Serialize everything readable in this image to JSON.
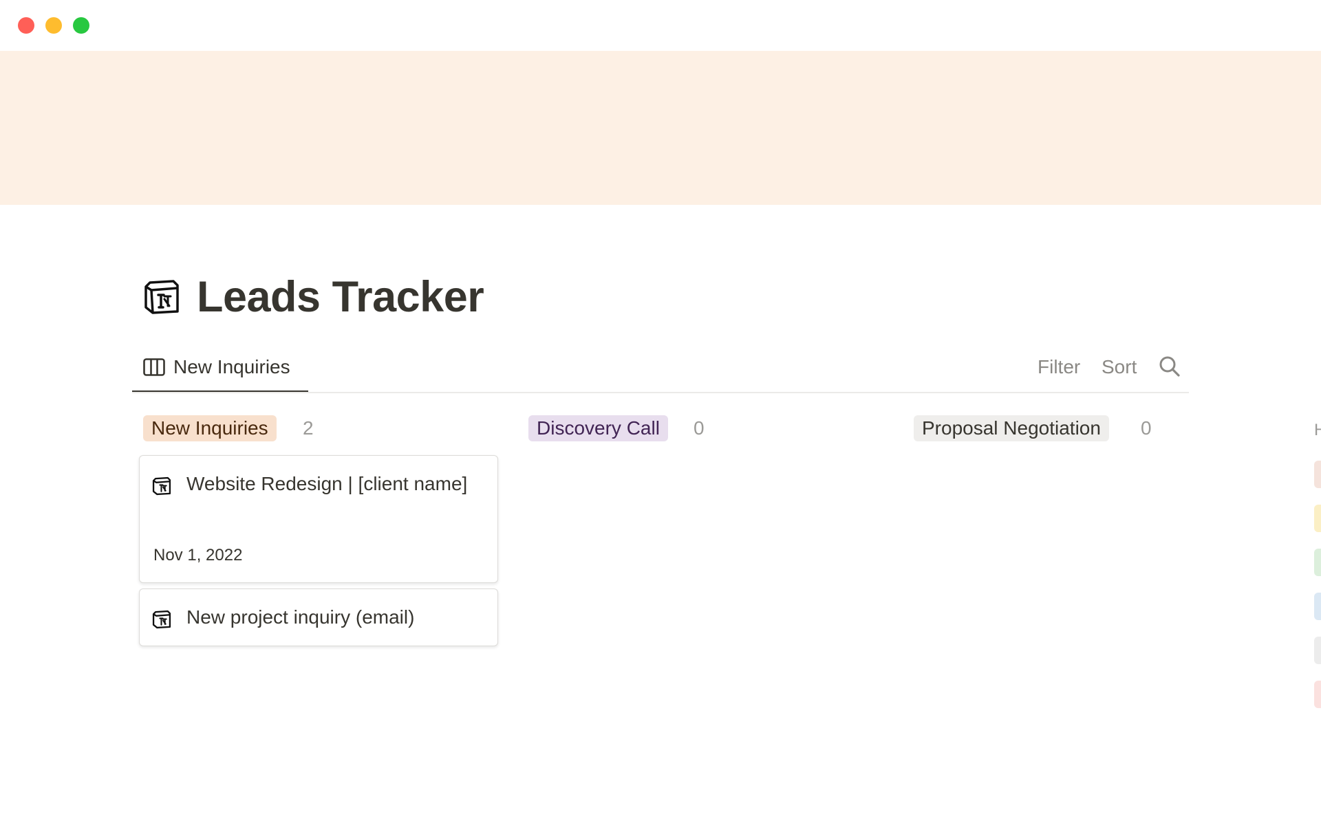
{
  "window": {
    "traffic_lights": [
      "close",
      "minimize",
      "maximize"
    ]
  },
  "page": {
    "title": "Leads Tracker",
    "icon": "notion-logo-icon",
    "cover_color": "#fdf0e4"
  },
  "view": {
    "tab_label": "New Inquiries",
    "tab_icon": "board-view-icon",
    "actions": {
      "filter": "Filter",
      "sort": "Sort",
      "search_icon": "search-icon"
    }
  },
  "board": {
    "columns": [
      {
        "label": "New Inquiries",
        "count": "2",
        "tag_color": "#f8e0cd",
        "cards": [
          {
            "title": "Website Redesign | [client name]",
            "date": "Nov 1, 2022",
            "icon": "notion-page-icon"
          },
          {
            "title": "New project inquiry (email)",
            "icon": "notion-page-icon"
          }
        ]
      },
      {
        "label": "Discovery Call",
        "count": "0",
        "tag_color": "#e8deee",
        "cards": []
      },
      {
        "label": "Proposal Negotiation",
        "count": "0",
        "tag_color": "#efeeec",
        "cards": []
      }
    ],
    "offscreen_column_colors": [
      "#f5e3dc",
      "#fbefc5",
      "#dcefdc",
      "#dbe8f4",
      "#ececec",
      "#fbe1df"
    ]
  }
}
